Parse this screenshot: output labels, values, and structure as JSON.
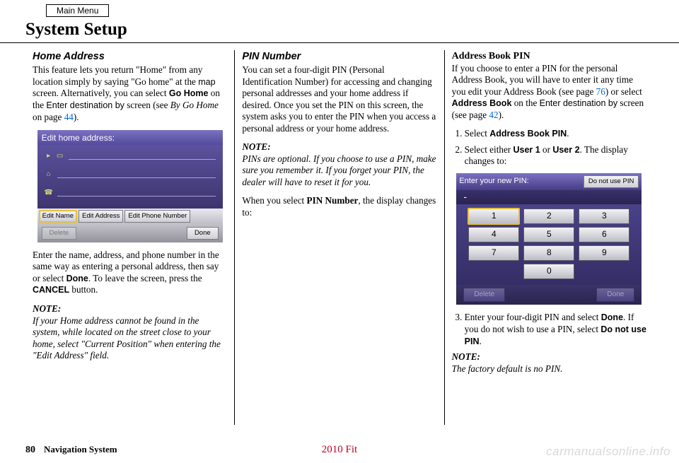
{
  "header": {
    "main_menu": "Main Menu",
    "page_title": "System Setup"
  },
  "col1": {
    "heading": "Home Address",
    "para1_a": "This feature lets you return \"Home\" from any location simply by saying \"Go home\" at the ",
    "para1_b": "map",
    "para1_c": " screen. Alternatively, you can select ",
    "para1_d": "Go Home",
    "para1_e": " on the ",
    "para1_f": "Enter destination by",
    "para1_g": " screen (see ",
    "para1_h": "By Go Home",
    "para1_i": " on page ",
    "para1_link": "44",
    "para1_j": ").",
    "screen1": {
      "title": "Edit home address:",
      "btn_edit_name": "Edit Name",
      "btn_edit_address": "Edit Address",
      "btn_edit_phone": "Edit Phone Number",
      "btn_delete": "Delete",
      "btn_done": "Done"
    },
    "para2_a": "Enter the name, address, and phone number in the same way as entering a personal address, then say or select ",
    "para2_b": "Done",
    "para2_c": ". To leave the screen, press the ",
    "para2_d": "CANCEL",
    "para2_e": " button.",
    "note_label": "NOTE:",
    "note_body": "If your Home address cannot be found in the system, while located on the street close to your home, select \"Current Position\" when entering the \"Edit Address\" field."
  },
  "col2": {
    "heading": "PIN Number",
    "para1": "You can set a four-digit PIN (Personal Identification Number) for accessing and changing personal addresses and your home address if desired. Once you set the PIN on this screen, the system asks you to enter the PIN when you access a personal address or your home address.",
    "note_label": "NOTE:",
    "note_body": "PINs are optional. If you choose to use a PIN, make sure you remember it. If you forget your PIN, the dealer will have to reset it for you.",
    "para2_a": "When you select ",
    "para2_b": "PIN Number",
    "para2_c": ", the display changes to:"
  },
  "col3": {
    "subheading": "Address Book PIN",
    "para1_a": "If you choose to enter a PIN for the personal Address Book, you will have to enter it any time you edit your Address Book (see page ",
    "para1_link1": "76",
    "para1_b": ") or select ",
    "para1_c": "Address Book",
    "para1_d": " on the ",
    "para1_e": "Enter destination by",
    "para1_f": " screen (see page ",
    "para1_link2": "42",
    "para1_g": ").",
    "step1_a": "Select ",
    "step1_b": "Address Book PIN",
    "step1_c": ".",
    "step2_a": "Select either ",
    "step2_b": "User 1",
    "step2_c": " or ",
    "step2_d": "User 2",
    "step2_e": ". The display changes to:",
    "screen2": {
      "title": "Enter your new PIN:",
      "btn_nopin": "Do not use PIN",
      "display": "-",
      "keys": [
        "1",
        "2",
        "3",
        "4",
        "5",
        "6",
        "7",
        "8",
        "9",
        "0"
      ],
      "btn_delete": "Delete",
      "btn_done": "Done"
    },
    "step3_a": "Enter your four-digit PIN and select ",
    "step3_b": "Done",
    "step3_c": ". If you do not wish to use a PIN, select ",
    "step3_d": "Do not use PIN",
    "step3_e": ".",
    "note_label": "NOTE:",
    "note_body": "The factory default is no PIN."
  },
  "footer": {
    "page_no": "80",
    "title": "Navigation System",
    "model": "2010 Fit",
    "watermark": "carmanualsonline.info"
  }
}
